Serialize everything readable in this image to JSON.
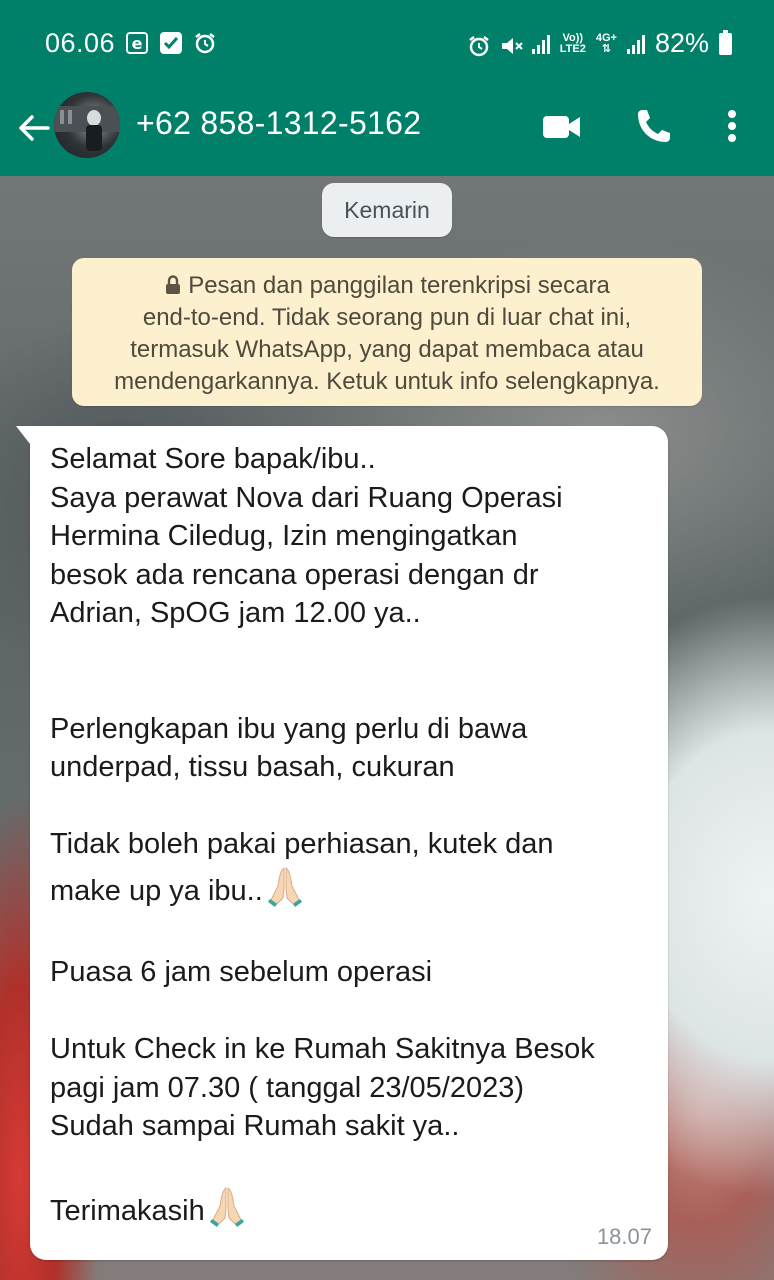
{
  "status_bar": {
    "time": "06.06",
    "network_label_top": "Vo))",
    "network_label_bottom": "LTE2",
    "network_type": "4G+",
    "battery": "82%",
    "left_icons": [
      "email-icon",
      "check-square-icon",
      "alarm-icon"
    ],
    "right_icons": [
      "alarm-icon",
      "mute-icon",
      "signal-icon",
      "signal-icon",
      "battery-icon"
    ]
  },
  "header": {
    "contact_name": "+62 858-1312-5162",
    "icons": [
      "back-arrow-icon",
      "video-call-icon",
      "phone-icon",
      "more-vert-icon"
    ],
    "accent_color": "#008069"
  },
  "chat": {
    "date_chip": "Kemarin",
    "encryption_notice": {
      "line1": "Pesan dan panggilan terenkripsi secara",
      "line2": "end-to-end. Tidak seorang pun di luar chat ini,",
      "line3": "termasuk WhatsApp, yang dapat membaca atau",
      "line4": "mendengarkannya. Ketuk untuk info selengkapnya."
    },
    "message": {
      "line1": "Selamat Sore bapak/ibu..",
      "line2": "Saya perawat Nova dari Ruang Operasi",
      "line3": "Hermina Ciledug, Izin mengingatkan",
      "line4": "besok ada rencana operasi dengan dr",
      "line5": "Adrian, SpOG jam 12.00 ya..",
      "line6": "Perlengkapan ibu yang perlu di bawa",
      "line7": "underpad, tissu basah, cukuran",
      "line8": "Tidak boleh pakai perhiasan, kutek dan",
      "line9": "make up ya ibu..",
      "line10": "Puasa 6 jam sebelum operasi",
      "line11": "Untuk Check in ke Rumah Sakitnya Besok",
      "line12": "pagi jam 07.30 ( tanggal 23/05/2023)",
      "line13": "Sudah sampai Rumah sakit ya..",
      "line14": "Terimakasih",
      "time": "18.07"
    }
  }
}
